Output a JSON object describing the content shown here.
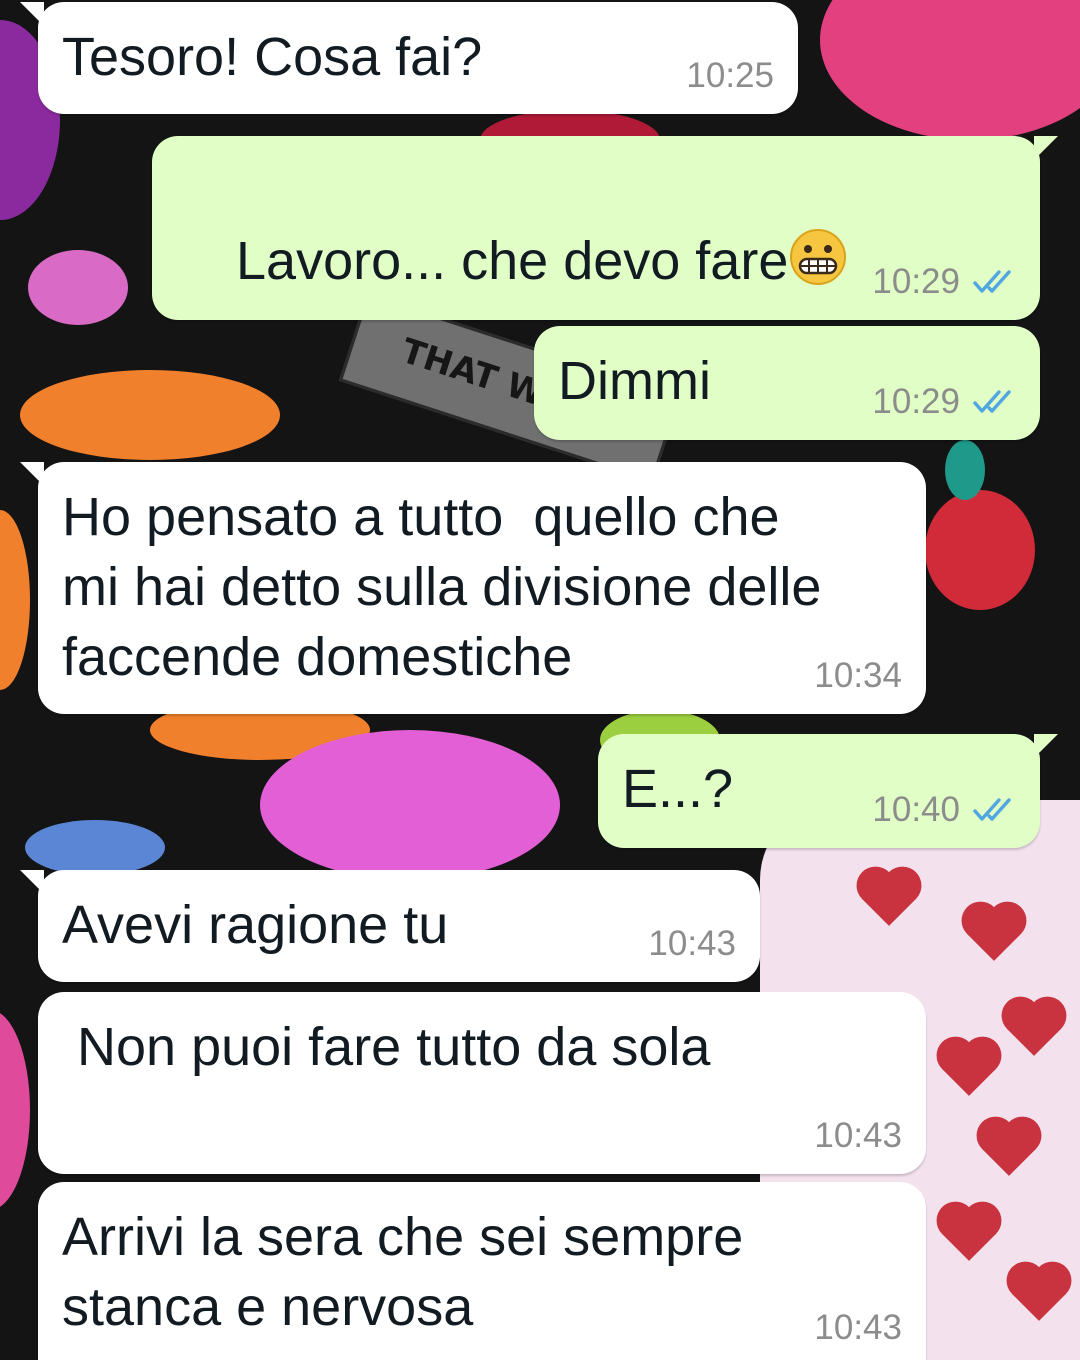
{
  "chat": {
    "messages": [
      {
        "direction": "incoming",
        "text": "Tesoro! Cosa fai?",
        "time": "10:25"
      },
      {
        "direction": "outgoing",
        "text": "Lavoro... che devo fare",
        "emoji": "grimacing-face",
        "time": "10:29",
        "status": "read"
      },
      {
        "direction": "outgoing",
        "text": "Dimmi",
        "time": "10:29",
        "status": "read"
      },
      {
        "direction": "incoming",
        "text": "Ho pensato a tutto  quello che\nmi hai detto sulla divisione delle\nfaccende domestiche",
        "time": "10:34"
      },
      {
        "direction": "outgoing",
        "text": "E...?",
        "time": "10:40",
        "status": "read"
      },
      {
        "direction": "incoming",
        "text": "Avevi ragione tu",
        "time": "10:43"
      },
      {
        "direction": "incoming",
        "text": " Non puoi fare tutto da sola",
        "time": "10:43"
      },
      {
        "direction": "incoming",
        "text": "Arrivi la sera che sei sempre\nstanca e nervosa",
        "time": "10:43"
      }
    ]
  },
  "wallpaper": {
    "sign_text": "THAT W"
  },
  "colors": {
    "incoming_bubble": "#ffffff",
    "outgoing_bubble": "#e2fec7",
    "read_ticks": "#4fa6e0",
    "timestamp": "#8c8c8c",
    "background": "#141414"
  },
  "icons": {
    "read_status": "double-check-icon"
  }
}
